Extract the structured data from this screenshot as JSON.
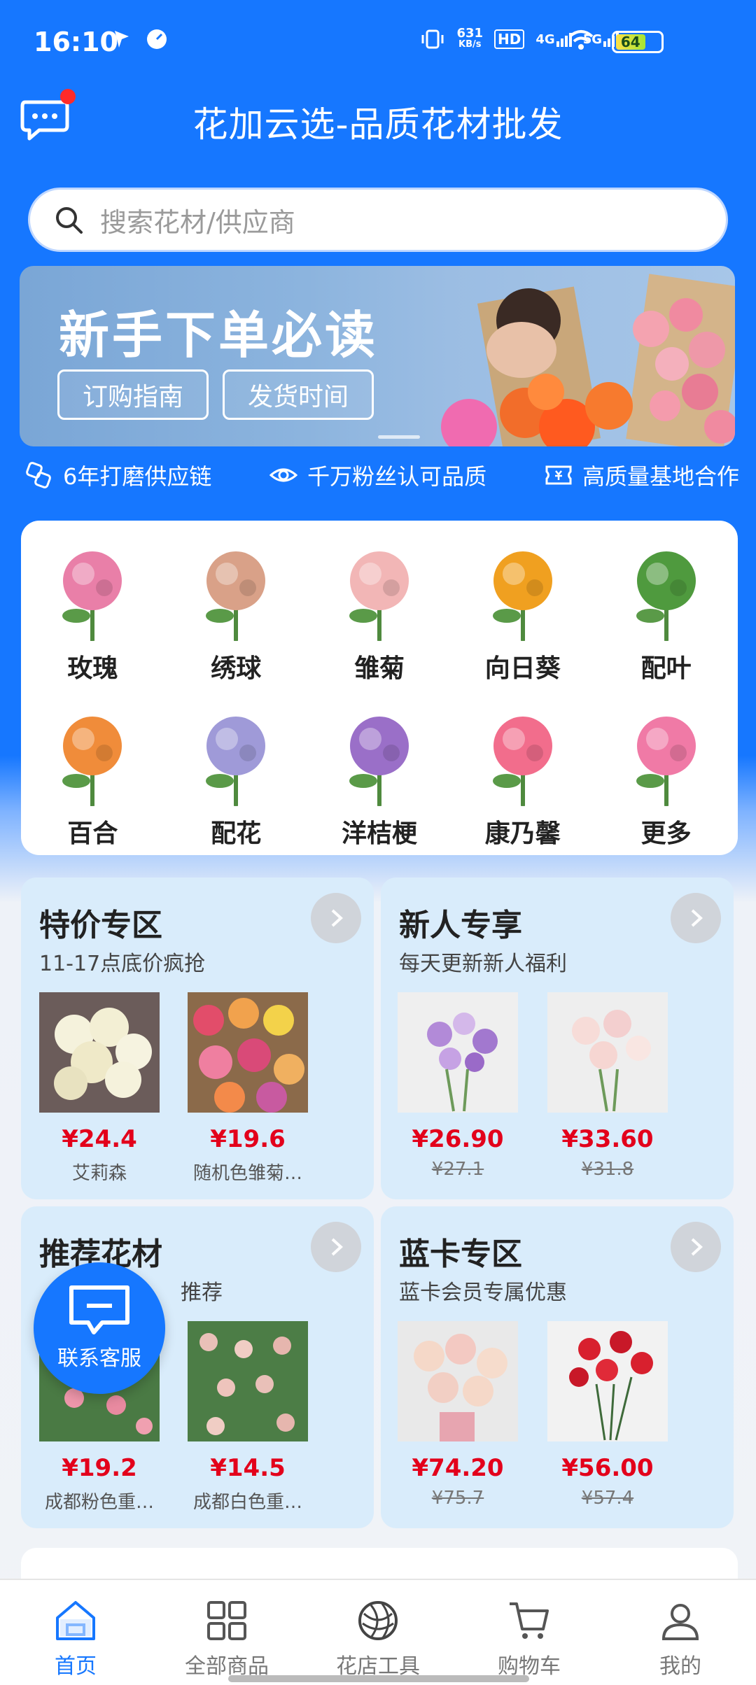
{
  "status": {
    "time": "16:10",
    "net_speed": "631",
    "net_unit": "KB/s",
    "hd": "HD",
    "net1": "4G",
    "net2": "5G",
    "battery": "64"
  },
  "header": {
    "title": "花加云选-品质花材批发"
  },
  "search": {
    "placeholder": "搜索花材/供应商"
  },
  "banner": {
    "title": "新手下单必读",
    "btn1": "订购指南",
    "btn2": "发货时间"
  },
  "features": [
    {
      "label": "6年打磨供应链",
      "icon": "link-icon"
    },
    {
      "label": "千万粉丝认可品质",
      "icon": "eye-icon"
    },
    {
      "label": "高质量基地合作",
      "icon": "ticket-icon"
    }
  ],
  "categories": [
    {
      "label": "玫瑰",
      "color": "#e97fa8"
    },
    {
      "label": "绣球",
      "color": "#d9a188"
    },
    {
      "label": "雏菊",
      "color": "#f2b6b6"
    },
    {
      "label": "向日葵",
      "color": "#f0a020"
    },
    {
      "label": "配叶",
      "color": "#4f9a3e"
    },
    {
      "label": "百合",
      "color": "#f08c3a"
    },
    {
      "label": "配花",
      "color": "#9f9ad8"
    },
    {
      "label": "洋桔梗",
      "color": "#9a6fc8"
    },
    {
      "label": "康乃馨",
      "color": "#f26d8c"
    },
    {
      "label": "更多",
      "color": "#f07aa6"
    }
  ],
  "promos": {
    "special": {
      "title": "特价专区",
      "subtitle": "11-17点底价疯抢",
      "items": [
        {
          "price": "¥24.4",
          "name": "艾莉森"
        },
        {
          "price": "¥19.6",
          "name": "随机色雏菊…"
        }
      ]
    },
    "newuser": {
      "title": "新人专享",
      "subtitle": "每天更新新人福利",
      "items": [
        {
          "price": "¥26.90",
          "old": "¥27.1"
        },
        {
          "price": "¥33.60",
          "old": "¥31.8"
        }
      ]
    },
    "recommend": {
      "title": "推荐花材",
      "subtitle_tail": "推荐",
      "items": [
        {
          "price": "¥19.2",
          "name": "成都粉色重…"
        },
        {
          "price": "¥14.5",
          "name": "成都白色重…"
        }
      ]
    },
    "bluecard": {
      "title": "蓝卡专区",
      "subtitle": "蓝卡会员专属优惠",
      "items": [
        {
          "price": "¥74.20",
          "old": "¥75.7"
        },
        {
          "price": "¥56.00",
          "old": "¥57.4"
        }
      ]
    }
  },
  "service": {
    "label": "联系客服"
  },
  "tabs": [
    {
      "label": "首页",
      "icon": "home-icon",
      "active": true
    },
    {
      "label": "全部商品",
      "icon": "grid-icon"
    },
    {
      "label": "花店工具",
      "icon": "yarn-icon"
    },
    {
      "label": "购物车",
      "icon": "cart-icon"
    },
    {
      "label": "我的",
      "icon": "user-icon"
    }
  ],
  "colors": {
    "brand": "#1677ff",
    "price": "#e3001b",
    "card": "#d9ecfb"
  }
}
